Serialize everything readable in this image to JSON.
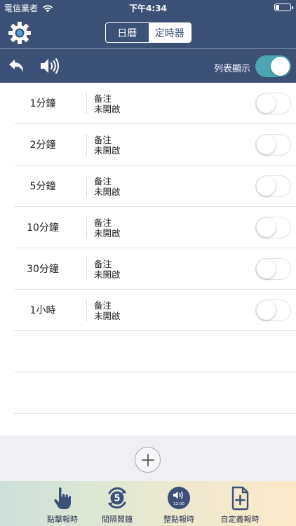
{
  "status_bar": {
    "carrier": "電信業者",
    "time": "下午4:34"
  },
  "header": {
    "tabs": [
      {
        "label": "日曆",
        "active": false
      },
      {
        "label": "定時器",
        "active": true
      }
    ],
    "list_view_label": "列表顯示",
    "list_view_on": true
  },
  "timers": [
    {
      "label": "1分鐘",
      "note": "备注",
      "status": "未開啟",
      "on": false
    },
    {
      "label": "2分鐘",
      "note": "备注",
      "status": "未開啟",
      "on": false
    },
    {
      "label": "5分鐘",
      "note": "备注",
      "status": "未開啟",
      "on": false
    },
    {
      "label": "10分鐘",
      "note": "备注",
      "status": "未開啟",
      "on": false
    },
    {
      "label": "30分鐘",
      "note": "备注",
      "status": "未開啟",
      "on": false
    },
    {
      "label": "1小時",
      "note": "备注",
      "status": "未開啟",
      "on": false
    }
  ],
  "tab_bar": {
    "items": [
      {
        "label": "點擊報時",
        "icon": "hand-pointer-icon"
      },
      {
        "label": "間隔鬧鐘",
        "icon": "interval-5-icon",
        "badge": "5"
      },
      {
        "label": "整點報時",
        "icon": "speaker-clock-icon",
        "badge": "12:00"
      },
      {
        "label": "自定義報時",
        "icon": "custom-document-icon"
      }
    ]
  },
  "colors": {
    "header_bg": "#3d5178",
    "toggle_on": "#4aa6b3",
    "accent": "#2b3450"
  }
}
